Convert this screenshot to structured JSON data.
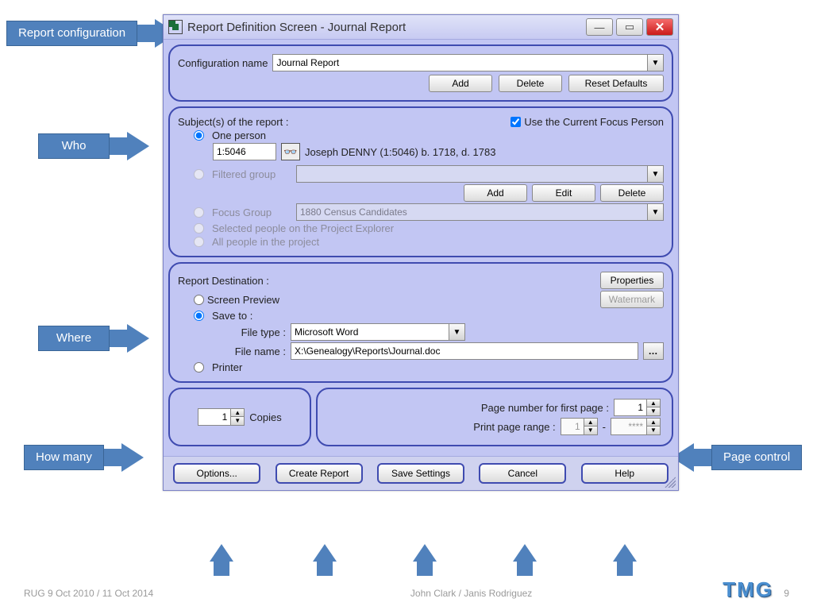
{
  "title": "Report Definition Screen - Journal Report",
  "callouts": {
    "config": "Report configuration",
    "who": "Who",
    "where": "Where",
    "howmany": "How many",
    "pagectrl": "Page control"
  },
  "config": {
    "label": "Configuration name",
    "value": "Journal Report",
    "add": "Add",
    "delete": "Delete",
    "reset": "Reset Defaults"
  },
  "subjects": {
    "title": "Subject(s) of the report :",
    "use_focus": "Use the Current Focus Person",
    "one_person": "One person",
    "person_id": "1:5046",
    "person_name": "Joseph DENNY (1:5046) b. 1718, d. 1783",
    "filtered": "Filtered group",
    "fg_add": "Add",
    "fg_edit": "Edit",
    "fg_delete": "Delete",
    "focus_group": "Focus Group",
    "focus_group_value": "1880 Census Candidates",
    "sel_pe": "Selected people on the Project Explorer",
    "all": "All people in the project"
  },
  "dest": {
    "title": "Report Destination :",
    "properties": "Properties",
    "watermark": "Watermark",
    "screen": "Screen Preview",
    "saveto": "Save to :",
    "filetype": "File type :",
    "filetype_value": "Microsoft Word",
    "filename": "File name :",
    "filename_value": "X:\\Genealogy\\Reports\\Journal.doc",
    "printer": "Printer"
  },
  "copies": {
    "value": "1",
    "label": "Copies"
  },
  "pages": {
    "first_label": "Page number for first page :",
    "first_value": "1",
    "range_label": "Print page range :",
    "range_from": "1",
    "range_to": "****"
  },
  "buttons": {
    "options": "Options...",
    "create": "Create Report",
    "save": "Save Settings",
    "cancel": "Cancel",
    "help": "Help"
  },
  "footer": {
    "left": "RUG 9 Oct 2010 / 11 Oct 2014",
    "center": "John Clark / Janis Rodriguez",
    "page": "9",
    "logo": "TMG"
  }
}
